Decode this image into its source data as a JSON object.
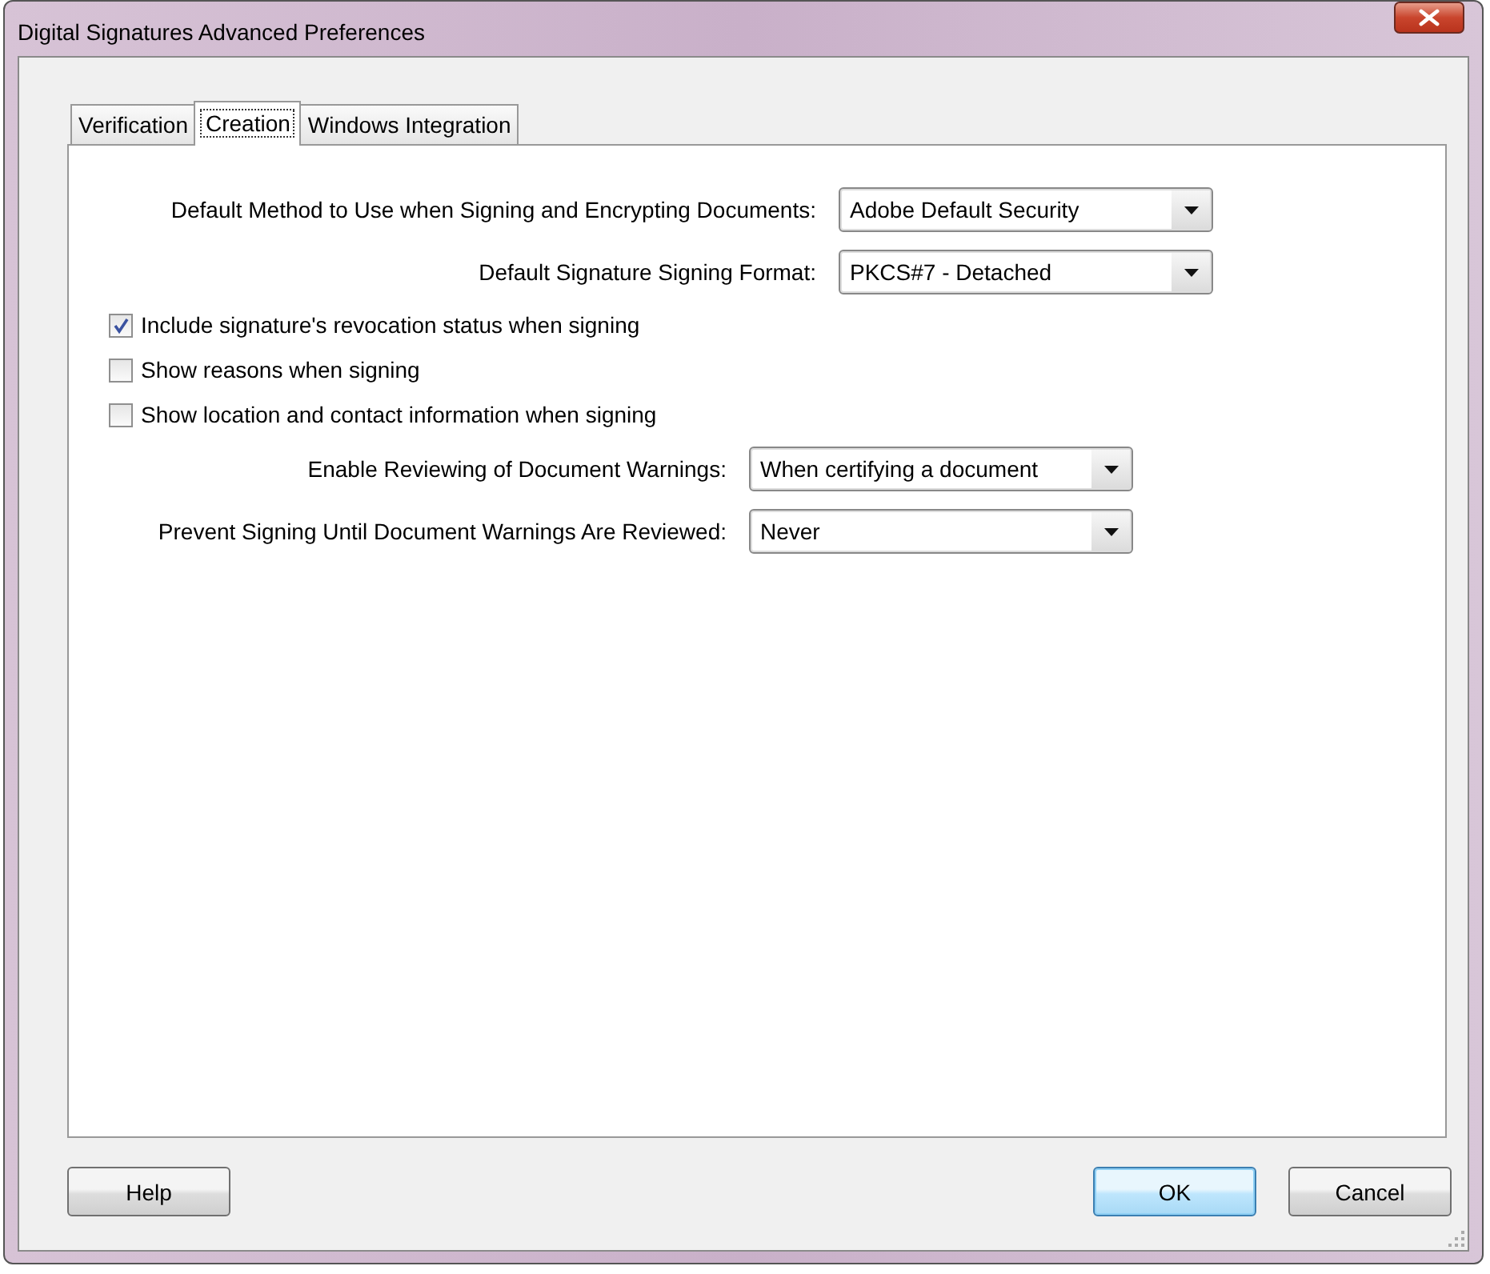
{
  "window": {
    "title": "Digital Signatures Advanced Preferences"
  },
  "tabs": [
    {
      "label": "Verification",
      "selected": false
    },
    {
      "label": "Creation",
      "selected": true
    },
    {
      "label": "Windows Integration",
      "selected": false
    }
  ],
  "signing_fields": [
    {
      "label": "Default Method to Use when Signing and Encrypting Documents:",
      "value": "Adobe Default Security"
    },
    {
      "label": "Default Signature Signing Format:",
      "value": "PKCS#7 - Detached"
    }
  ],
  "options": [
    {
      "label": "Include signature's revocation status when signing",
      "checked": true
    },
    {
      "label": "Show reasons when signing",
      "checked": false
    },
    {
      "label": "Show location and contact information when signing",
      "checked": false
    }
  ],
  "warning_fields": [
    {
      "label": "Enable Reviewing of Document Warnings:",
      "value": "When certifying a document"
    },
    {
      "label": "Prevent Signing Until Document Warnings Are Reviewed:",
      "value": "Never"
    }
  ],
  "buttons": [
    {
      "label": "Help",
      "kind": "plain"
    },
    {
      "label": "OK",
      "kind": "default"
    },
    {
      "label": "Cancel",
      "kind": "plain"
    }
  ]
}
